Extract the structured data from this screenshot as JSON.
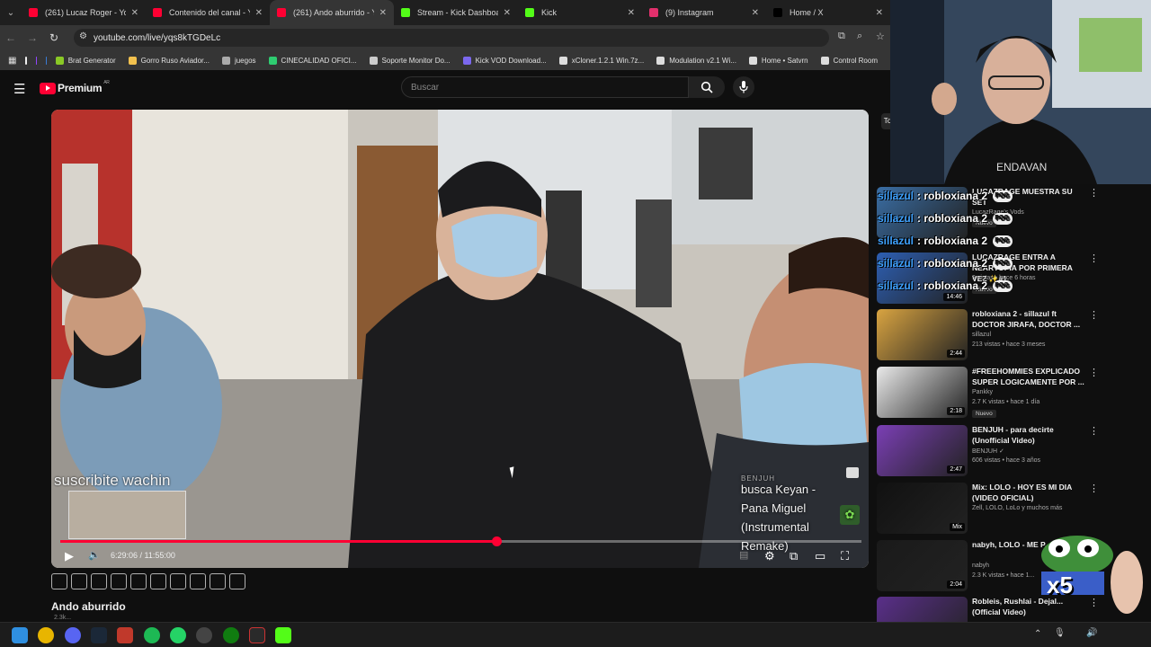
{
  "browser": {
    "tabs": [
      {
        "label": "(261) Lucaz Roger - YouTube",
        "favicon_color": "#ff0033",
        "active": false
      },
      {
        "label": "Contenido del canal - YouTube",
        "favicon_color": "#ff0033",
        "active": false
      },
      {
        "label": "(261) Ando aburrido - YouTube",
        "favicon_color": "#ff0033",
        "active": true
      },
      {
        "label": "Stream - Kick Dashboard",
        "favicon_color": "#53fc18",
        "active": false
      },
      {
        "label": "Kick",
        "favicon_color": "#53fc18",
        "active": false
      },
      {
        "label": "(9) Instagram",
        "favicon_color": "#e1306c",
        "active": false
      },
      {
        "label": "Home / X",
        "favicon_color": "#000000",
        "active": false
      }
    ],
    "url": "youtube.com/live/yqs8kTGDeLc",
    "bookmarks": [
      {
        "label": "Brat Generator",
        "color": "#8ac926"
      },
      {
        "label": "Gorro Ruso Aviador...",
        "color": "#f2c14e"
      },
      {
        "label": "juegos",
        "color": "#aaaaaa"
      },
      {
        "label": "CINECALIDAD OFICI...",
        "color": "#2ecc71"
      },
      {
        "label": "Soporte Monitor Do...",
        "color": "#cccccc"
      },
      {
        "label": "Kick VOD Download...",
        "color": "#7b68ee"
      },
      {
        "label": "xCloner.1.2.1 Win.7z...",
        "color": "#dddddd"
      },
      {
        "label": "Modulation v2.1 Wi...",
        "color": "#dddddd"
      },
      {
        "label": "Home • Satvrn",
        "color": "#dddddd"
      },
      {
        "label": "Control Room",
        "color": "#dddddd"
      }
    ]
  },
  "youtube": {
    "logo_text": "Premium",
    "logo_region": "AR",
    "search_placeholder": "Buscar"
  },
  "player": {
    "overlay_text": "suscribite wachin",
    "music_card": {
      "tag": "BENJUH",
      "line1": "busca Keyan -",
      "line2": "Pana Miguel",
      "line3": "(Instrumental",
      "line4": "Remake)"
    },
    "time_current": "6:29:06",
    "time_total": "11:55:00",
    "time_sep": " / ",
    "progress_fraction": 0.544
  },
  "video": {
    "title": "Ando aburrido",
    "channel_sub": "2.3k..."
  },
  "chat_overlay": [
    {
      "user": "sillazul",
      "text": ": robloxiana 2",
      "emote": "POG"
    },
    {
      "user": "sillazul",
      "text": ": robloxiana 2",
      "emote": "POG"
    },
    {
      "user": "sillazul",
      "text": ": robloxiana 2",
      "emote": "POG"
    },
    {
      "user": "sillazul",
      "text": ": robloxiana 2",
      "emote": "POG"
    },
    {
      "user": "sillazul",
      "text": ": robloxiana 2",
      "emote": "POG"
    }
  ],
  "recommendations": [
    {
      "title": "LUCAZRAGE MUESTRA SU SET",
      "channel": "LucazRage's Vods",
      "meta": "",
      "duration": "",
      "nuevo": "Nuevo",
      "thumb": "#3a6ea5"
    },
    {
      "title": "LUCAZRAGE ENTRA A NEARTOPIA POR PRIMERA VEZ ✨#1",
      "channel": "",
      "meta": "9 vistas • hace 6 horas",
      "duration": "14:46",
      "nuevo": "Nuevo",
      "thumb": "#2d5fb3"
    },
    {
      "title": "robloxiana 2 - sillazul ft DOCTOR JIRAFA, DOCTOR ...",
      "channel": "sillazul",
      "meta": "213 vistas • hace 3 meses",
      "duration": "2:44",
      "nuevo": "",
      "thumb": "#d9a441"
    },
    {
      "title": "#FREEHOMMIES EXPLICADO SUPER LOGICAMENTE POR ...",
      "channel": "Pankky",
      "meta": "2.7 K vistas • hace 1 día",
      "duration": "2:18",
      "nuevo": "Nuevo",
      "thumb": "#eaeaea"
    },
    {
      "title": "BENJUH - para decirte (Unofficial Video)",
      "channel": "BENJUH ✓",
      "meta": "606 vistas • hace 3 años",
      "duration": "2:47",
      "nuevo": "",
      "thumb": "#7b3fb5"
    },
    {
      "title": "Mix: LOLO - HOY ES MI DIA (VIDEO OFICIAL)",
      "channel": "Zell, LOLO, LoLo y muchos más",
      "meta": "",
      "duration": "Mix",
      "nuevo": "",
      "thumb": "#111111"
    },
    {
      "title": "nabyh, LOLO - ME P... KEMÁ",
      "channel": "nabyh",
      "meta": "2.3 K vistas • hace 1...",
      "duration": "2:04",
      "nuevo": "",
      "thumb": "#1a1a1a"
    },
    {
      "title": "Robleis, Rushlai - Dejal... (Official Video)",
      "channel": "",
      "meta": "",
      "duration": "",
      "nuevo": "",
      "thumb": "#5a2f8a"
    }
  ],
  "sidebar_top_chip": "To",
  "pepe": {
    "caption": "x5"
  }
}
